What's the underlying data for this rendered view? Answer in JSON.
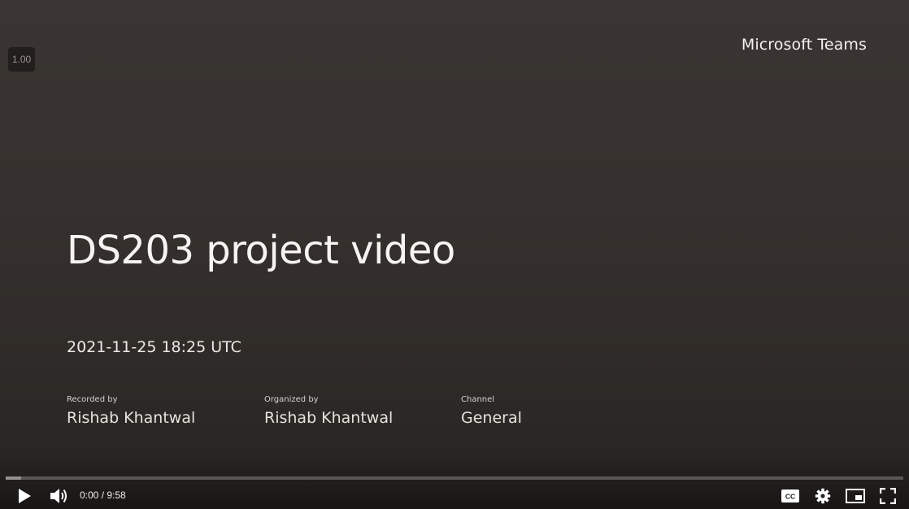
{
  "player": {
    "speed_indicator": "1.00",
    "brand": "Microsoft Teams",
    "title": "DS203 project video",
    "date": "2021-11-25 18:25 UTC",
    "recorded_by": {
      "label": "Recorded by",
      "value": "Rishab Khantwal"
    },
    "organized_by": {
      "label": "Organized by",
      "value": "Rishab Khantwal"
    },
    "channel": {
      "label": "Channel",
      "value": "General"
    }
  },
  "controls": {
    "current_time": "0:00",
    "duration": "9:58",
    "time_display": "0:00 / 9:58",
    "progress_played_fraction": 0.0,
    "progress_loaded_fraction": 0.017,
    "play_icon": "play-icon",
    "volume_icon": "volume-icon",
    "captions_icon": "closed-captions-icon",
    "settings_icon": "gear-icon",
    "miniplayer_icon": "miniplayer-icon",
    "fullscreen_icon": "fullscreen-icon",
    "accent_color": "#ff0000"
  }
}
